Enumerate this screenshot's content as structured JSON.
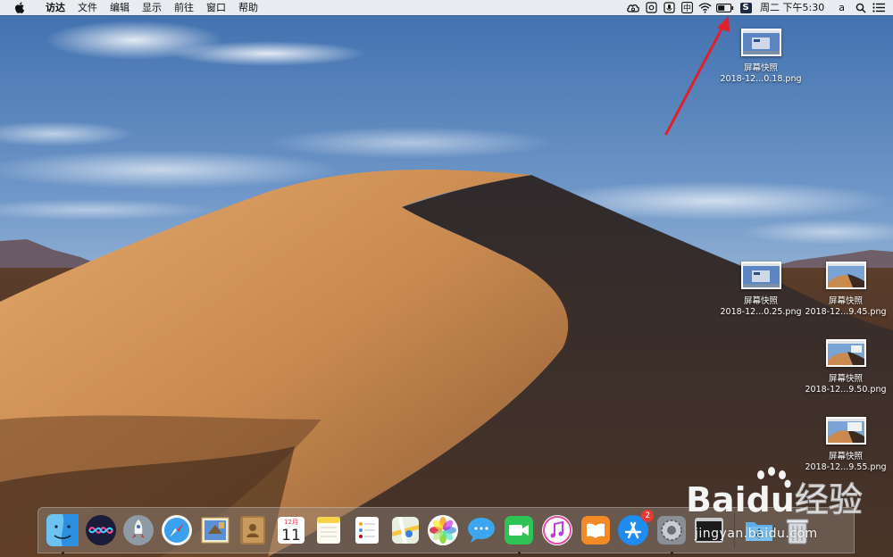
{
  "menubar": {
    "apple_icon": "apple-icon",
    "items": [
      "访达",
      "文件",
      "编辑",
      "显示",
      "前往",
      "窗口",
      "帮助"
    ],
    "tray_icons": [
      "creative-cloud-icon",
      "camera-icon",
      "microphone-icon",
      "input-method-icon",
      "wifi-icon",
      "battery-icon",
      "sogou-input-icon"
    ],
    "sogou_letter": "S",
    "input_method_char": "中",
    "clock": "周二 下午5:30",
    "user": "a",
    "spotlight_icon": "search-icon",
    "notification_icon": "list-icon"
  },
  "desktop_files": [
    {
      "title": "屏幕快照",
      "filename": "2018-12...0.18.png"
    },
    {
      "title": "屏幕快照",
      "filename": "2018-12...0.25.png"
    },
    {
      "title": "屏幕快照",
      "filename": "2018-12...9.45.png"
    },
    {
      "title": "屏幕快照",
      "filename": "2018-12...9.50.png"
    },
    {
      "title": "屏幕快照",
      "filename": "2018-12...9.55.png"
    }
  ],
  "dock": {
    "apps": [
      "finder",
      "siri",
      "launchpad",
      "safari",
      "mail",
      "contacts",
      "calendar",
      "notes",
      "reminders",
      "maps",
      "photos",
      "messages",
      "facetime",
      "itunes",
      "ibooks",
      "app-store",
      "system-preferences",
      "terminal"
    ],
    "calendar_month": "12月",
    "calendar_day": "11",
    "app_store_badge": "2",
    "right_items": [
      "downloads-folder",
      "trash"
    ]
  },
  "watermark": {
    "brand": "Baidu经验",
    "url": "jingyan.baidu.com"
  },
  "colors": {
    "annotation_arrow": "#e0202a",
    "menubar_bg": "#e9ecf0",
    "sky_top": "#3f6fae",
    "dune_light": "#c98a4f",
    "dune_dark": "#3a2a22"
  }
}
